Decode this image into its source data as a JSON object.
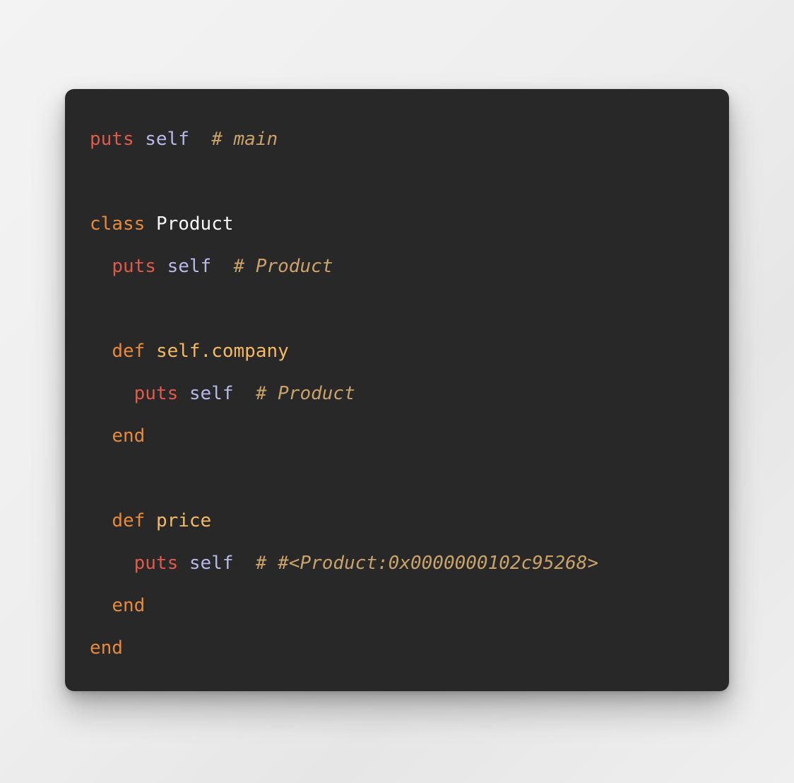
{
  "window": {
    "background_color": "#eeeeee",
    "card_background_color": "#282828"
  },
  "palette": {
    "keyword": "#e8893a",
    "method_call": "#e05a4a",
    "self_keyword": "#b8b8e8",
    "constant": "#f7f7f7",
    "def_name": "#f5b963",
    "comment": "#c9a26a",
    "plain": "#d8d8d8"
  },
  "code": {
    "language": "ruby",
    "full_text": "puts self  # main\n\nclass Product\n  puts self  # Product\n\n  def self.company\n    puts self  # Product\n  end\n\n  def price\n    puts self  # #<Product:0x0000000102c95268>\n  end\nend",
    "lines": [
      {
        "indent": "",
        "tokens": [
          {
            "type": "method_call",
            "text": "puts"
          },
          {
            "type": "plain",
            "text": " "
          },
          {
            "type": "self_keyword",
            "text": "self"
          },
          {
            "type": "plain",
            "text": "  "
          },
          {
            "type": "comment",
            "text": "# main"
          }
        ]
      },
      {
        "indent": "",
        "tokens": []
      },
      {
        "indent": "",
        "tokens": [
          {
            "type": "keyword",
            "text": "class"
          },
          {
            "type": "plain",
            "text": " "
          },
          {
            "type": "constant",
            "text": "Product"
          }
        ]
      },
      {
        "indent": "  ",
        "tokens": [
          {
            "type": "method_call",
            "text": "puts"
          },
          {
            "type": "plain",
            "text": " "
          },
          {
            "type": "self_keyword",
            "text": "self"
          },
          {
            "type": "plain",
            "text": "  "
          },
          {
            "type": "comment",
            "text": "# Product"
          }
        ]
      },
      {
        "indent": "",
        "tokens": []
      },
      {
        "indent": "  ",
        "tokens": [
          {
            "type": "keyword",
            "text": "def"
          },
          {
            "type": "plain",
            "text": " "
          },
          {
            "type": "def_name",
            "text": "self.company"
          }
        ]
      },
      {
        "indent": "    ",
        "tokens": [
          {
            "type": "method_call",
            "text": "puts"
          },
          {
            "type": "plain",
            "text": " "
          },
          {
            "type": "self_keyword",
            "text": "self"
          },
          {
            "type": "plain",
            "text": "  "
          },
          {
            "type": "comment",
            "text": "# Product"
          }
        ]
      },
      {
        "indent": "  ",
        "tokens": [
          {
            "type": "keyword",
            "text": "end"
          }
        ]
      },
      {
        "indent": "",
        "tokens": []
      },
      {
        "indent": "  ",
        "tokens": [
          {
            "type": "keyword",
            "text": "def"
          },
          {
            "type": "plain",
            "text": " "
          },
          {
            "type": "def_name",
            "text": "price"
          }
        ]
      },
      {
        "indent": "    ",
        "tokens": [
          {
            "type": "method_call",
            "text": "puts"
          },
          {
            "type": "plain",
            "text": " "
          },
          {
            "type": "self_keyword",
            "text": "self"
          },
          {
            "type": "plain",
            "text": "  "
          },
          {
            "type": "comment",
            "text": "# #<Product:0x0000000102c95268>"
          }
        ]
      },
      {
        "indent": "  ",
        "tokens": [
          {
            "type": "keyword",
            "text": "end"
          }
        ]
      },
      {
        "indent": "",
        "tokens": [
          {
            "type": "keyword",
            "text": "end"
          }
        ]
      }
    ]
  }
}
